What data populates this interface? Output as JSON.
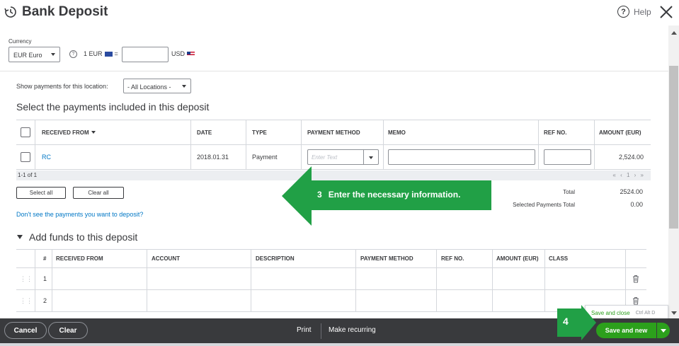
{
  "header": {
    "title": "Bank Deposit",
    "help_label": "Help",
    "help_glyph": "?"
  },
  "currency": {
    "label": "Currency",
    "selected": "EUR Euro",
    "rate_prefix": "1 EUR",
    "equals": "=",
    "rate_value": "",
    "rate_suffix": "USD"
  },
  "location": {
    "label": "Show payments for this location:",
    "selected": "- All Locations -"
  },
  "payments": {
    "section_title": "Select the payments included in this deposit",
    "columns": [
      "RECEIVED FROM",
      "DATE",
      "TYPE",
      "PAYMENT METHOD",
      "MEMO",
      "REF NO.",
      "AMOUNT (EUR)"
    ],
    "rows": [
      {
        "received_from": "RC",
        "date": "2018.01.31",
        "type": "Payment",
        "payment_method_placeholder": "Enter Text",
        "memo": "",
        "ref_no": "",
        "amount": "2,524.00"
      }
    ],
    "pager_text": "1-1 of 1",
    "pager_controls": "« ‹ 1 › »",
    "select_all": "Select all",
    "clear_all": "Clear all",
    "total_label": "Total",
    "total_value": "2524.00",
    "selected_total_label": "Selected Payments Total",
    "selected_total_value": "0.00",
    "dont_see_link": "Don't see the payments you want to deposit?"
  },
  "funds": {
    "section_title": "Add funds to this deposit",
    "columns": [
      "#",
      "RECEIVED FROM",
      "ACCOUNT",
      "DESCRIPTION",
      "PAYMENT METHOD",
      "REF NO.",
      "AMOUNT (EUR)",
      "CLASS"
    ],
    "rows": [
      {
        "num": "1"
      },
      {
        "num": "2"
      }
    ]
  },
  "footer": {
    "cancel": "Cancel",
    "clear": "Clear",
    "print": "Print",
    "make_recurring": "Make recurring",
    "save_and_new": "Save and new",
    "save_and_close": "Save and close",
    "save_and_close_shortcut": "Ctrl Alt D"
  },
  "callouts": {
    "step3_number": "3",
    "step3_text": "Enter the necessary information.",
    "step4_number": "4"
  },
  "colors": {
    "accent_green": "#2ca01c",
    "callout_green": "#21a046",
    "link_blue": "#0077c5",
    "footer_bg": "#393a3d"
  }
}
